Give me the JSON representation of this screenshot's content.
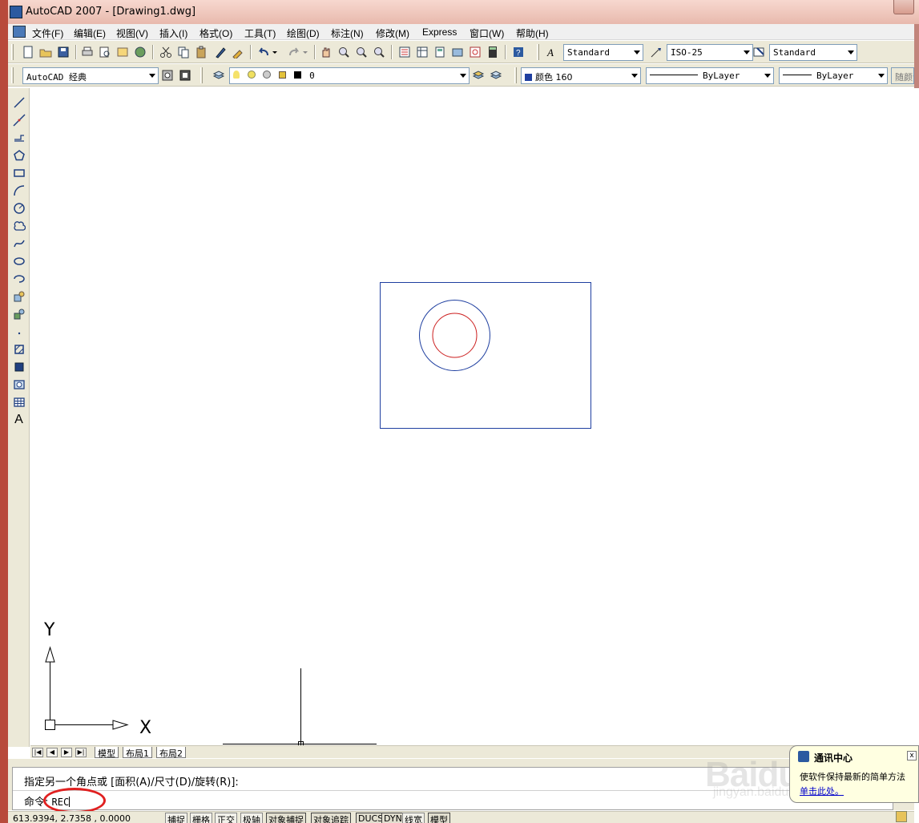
{
  "window": {
    "title": "AutoCAD 2007 - [Drawing1.dwg]"
  },
  "menubar": {
    "items": [
      "文件(F)",
      "编辑(E)",
      "视图(V)",
      "插入(I)",
      "格式(O)",
      "工具(T)",
      "绘图(D)",
      "标注(N)",
      "修改(M)",
      "Express",
      "窗口(W)",
      "帮助(H)"
    ]
  },
  "toolbar1": {
    "text_style": "Standard",
    "dim_style": "ISO-25",
    "table_style": "Standard"
  },
  "toolbar2": {
    "workspace": "AutoCAD 经典",
    "layer": "0",
    "color": "颜色 160",
    "linetype": "ByLayer",
    "lineweight": "ByLayer",
    "plotstyle": "随颜色"
  },
  "draw_toolbar": {
    "text_tool_label": "A"
  },
  "canvas": {
    "ucs_y_label": "Y",
    "ucs_x_label": "X",
    "colors": {
      "rectangle": "#1f3fa0",
      "outer_circle": "#1f3fa0",
      "inner_circle": "#cc1f1f"
    }
  },
  "tabs": {
    "items": [
      "模型",
      "布局1",
      "布局2"
    ],
    "active": "模型"
  },
  "command": {
    "history": "指定另一个角点或 [面积(A)/尺寸(D)/旋转(R)]:",
    "prompt": "命令:",
    "input": "REC"
  },
  "statusbar": {
    "coords": "613.9394,  2.7358  , 0.0000",
    "buttons": [
      "捕捉",
      "栅格",
      "正交",
      "极轴",
      "对象捕捉",
      "对象追踪",
      "DUCS",
      "DYN",
      "线宽",
      "模型"
    ]
  },
  "balloon": {
    "title": "通讯中心",
    "text": "使软件保持最新的简单方法",
    "link": "单击此处。"
  },
  "watermark": {
    "brand": "Baidu经验",
    "url": "jingyan.baidu.com"
  }
}
